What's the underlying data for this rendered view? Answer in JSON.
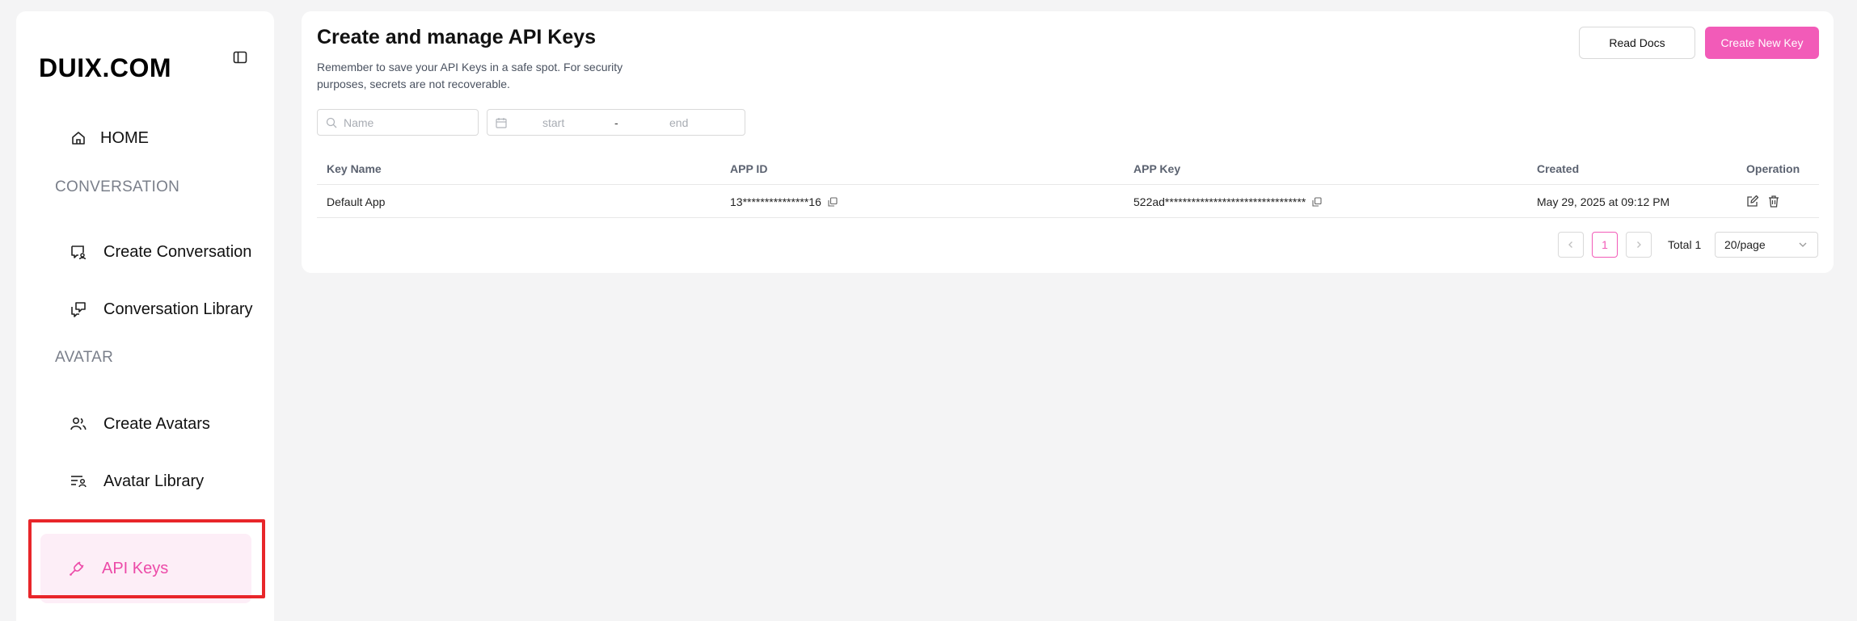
{
  "sidebar": {
    "logo": "DUIX.COM",
    "home": "HOME",
    "section_conversation": "CONVERSATION",
    "create_conversation": "Create Conversation",
    "conversation_library": "Conversation Library",
    "section_avatar": "AVATAR",
    "create_avatars": "Create Avatars",
    "avatar_library": "Avatar Library",
    "api_keys": "API Keys"
  },
  "header": {
    "title": "Create and manage API Keys",
    "subtitle": "Remember to save your API Keys in a safe spot. For security purposes, secrets are not recoverable.",
    "read_docs": "Read Docs",
    "create_new_key": "Create New Key"
  },
  "filters": {
    "name_placeholder": "Name",
    "date_start": "start",
    "date_separator": "-",
    "date_end": "end"
  },
  "table": {
    "columns": [
      "Key Name",
      "APP ID",
      "APP Key",
      "Created",
      "Operation"
    ],
    "rows": [
      {
        "key_name": "Default App",
        "app_id": "13***************16",
        "app_key": "522ad********************************",
        "created": "May 29, 2025 at 09:12 PM"
      }
    ]
  },
  "pagination": {
    "current_page": "1",
    "total": "Total 1",
    "page_size": "20/page"
  },
  "colors": {
    "accent": "#f25bb8",
    "active_bg": "#fdeef7",
    "highlight_border": "#e8262a"
  }
}
